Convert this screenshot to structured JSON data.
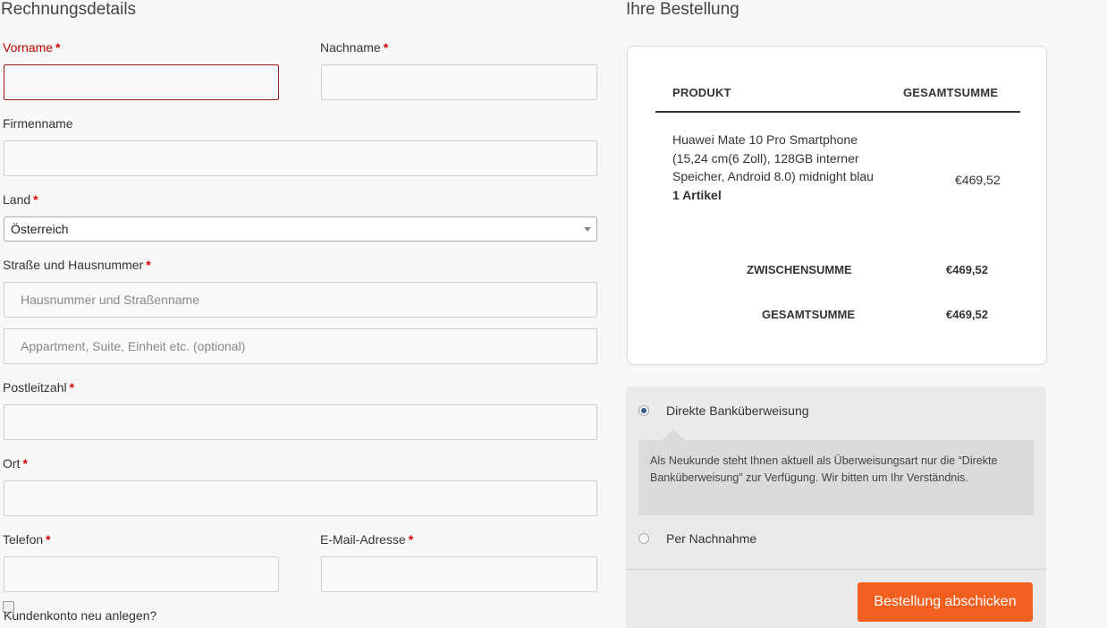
{
  "billing": {
    "heading": "Rechnungsdetails",
    "required_mark": "*",
    "first_name_label": "Vorname",
    "last_name_label": "Nachname",
    "company_label": "Firmenname",
    "country_label": "Land",
    "country_value": "Österreich",
    "street_label": "Straße und Hausnummer",
    "street_placeholder": "Hausnummer und Straßenname",
    "street2_placeholder": "Appartment, Suite, Einheit etc. (optional)",
    "postcode_label": "Postleitzahl",
    "city_label": "Ort",
    "phone_label": "Telefon",
    "email_label": "E-Mail-Adresse",
    "create_account_label": "Kundenkonto neu anlegen?"
  },
  "order": {
    "heading": "Ihre Bestellung",
    "col_product": "PRODUKT",
    "col_total": "GESAMTSUMME",
    "product_name": "Huawei Mate 10 Pro Smartphone (15,24 cm(6 Zoll), 128GB interner Speicher, Android 8.0) midnight blau",
    "product_qty": "1 Artikel",
    "product_price": "€469,52",
    "subtotal_label": "ZWISCHENSUMME",
    "subtotal_value": "€469,52",
    "total_label": "GESAMTSUMME",
    "total_value": "€469,52"
  },
  "payment": {
    "option_bank": "Direkte Banküberweisung",
    "option_bank_selected": true,
    "bank_note": "Als Neukunde steht Ihnen aktuell als Überweisungsart nur die “Direkte Banküberweisung” zur Verfügung. Wir bitten um Ihr Verständnis.",
    "option_cod": "Per Nachnahme",
    "submit_label": "Bestellung abschicken"
  },
  "colors": {
    "submit_button": "#f35f1f",
    "required_mark": "#dd0000",
    "error_border": "#9b1c1c"
  }
}
